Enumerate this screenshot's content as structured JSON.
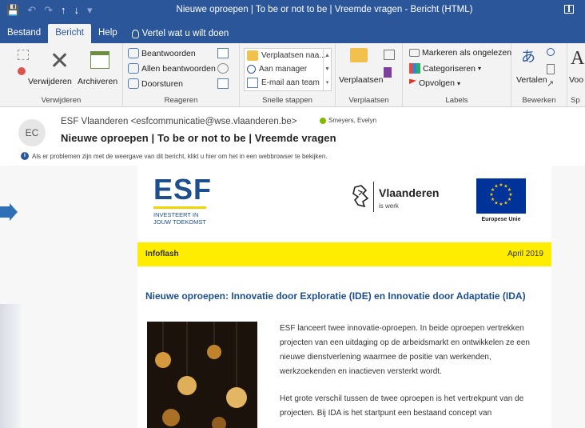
{
  "title_bar": {
    "title": "Nieuwe oproepen | To be or not to be | Vreemde vragen  -  Bericht (HTML)"
  },
  "tabs": [
    "Bestand",
    "Bericht",
    "Help"
  ],
  "tell_me": "Vertel wat u wilt doen",
  "ribbon": {
    "delete_group": {
      "delete_label": "Verwijderen",
      "archive_label": "Archiveren",
      "group_label": "Verwijderen"
    },
    "respond_group": {
      "reply": "Beantwoorden",
      "reply_all": "Allen beantwoorden",
      "forward": "Doorsturen",
      "group_label": "Reageren"
    },
    "quick_steps": {
      "items": [
        "Verplaatsen naa...",
        "Aan manager",
        "E-mail aan team"
      ],
      "group_label": "Snelle stappen"
    },
    "move_group": {
      "move_label": "Verplaatsen",
      "group_label": "Verplaatsen"
    },
    "tags_group": {
      "mark_unread": "Markeren als ongelezen",
      "categorize": "Categoriseren",
      "follow_up": "Opvolgen",
      "group_label": "Labels"
    },
    "editing_group": {
      "translate": "Vertalen",
      "group_label": "Bewerken"
    },
    "cut_off_group": {
      "button_label": "Voo",
      "group_label": "Sp"
    }
  },
  "message": {
    "avatar_initials": "EC",
    "sender": "ESF Vlaanderen <esfcommunicatie@wse.vlaanderen.be>",
    "recipient": "Smeyers, Evelyn",
    "subject": "Nieuwe oproepen | To be or not to be | Vreemde vragen",
    "info": "Als er problemen zijn met de weergave van dit bericht, klikt u hier om het in een webbrowser te bekijken."
  },
  "newsletter": {
    "esf_logo": "ESF",
    "esf_tagline_1": "INVESTEERT IN",
    "esf_tagline_2": "JOUW TOEKOMST",
    "vl_name": "Vlaanderen",
    "vl_sub": "is werk",
    "eu_label": "Europese Unie",
    "bar_left": "Infoflash",
    "bar_right": "April 2019",
    "headline": "Nieuwe oproepen: Innovatie door Exploratie (IDE) en Innovatie door Adaptatie (IDA)",
    "para_1": "ESF lanceert twee innovatie-oproepen. In beide oproepen vertrekken projecten van een uitdaging op de arbeidsmarkt en ontwikkelen ze een nieuwe dienstverlening waarmee de positie van werkenden, werkzoekenden en inactieven versterkt wordt.",
    "para_2": "Het grote verschil tussen de twee oproepen is het vertrekpunt van de projecten. Bij IDA is het startpunt een bestaand concept van"
  },
  "colors": {
    "office_blue": "#2b579a",
    "esf_blue": "#1d4f8f",
    "infoflash_yellow": "#ffed00",
    "eu_blue": "#003399"
  }
}
